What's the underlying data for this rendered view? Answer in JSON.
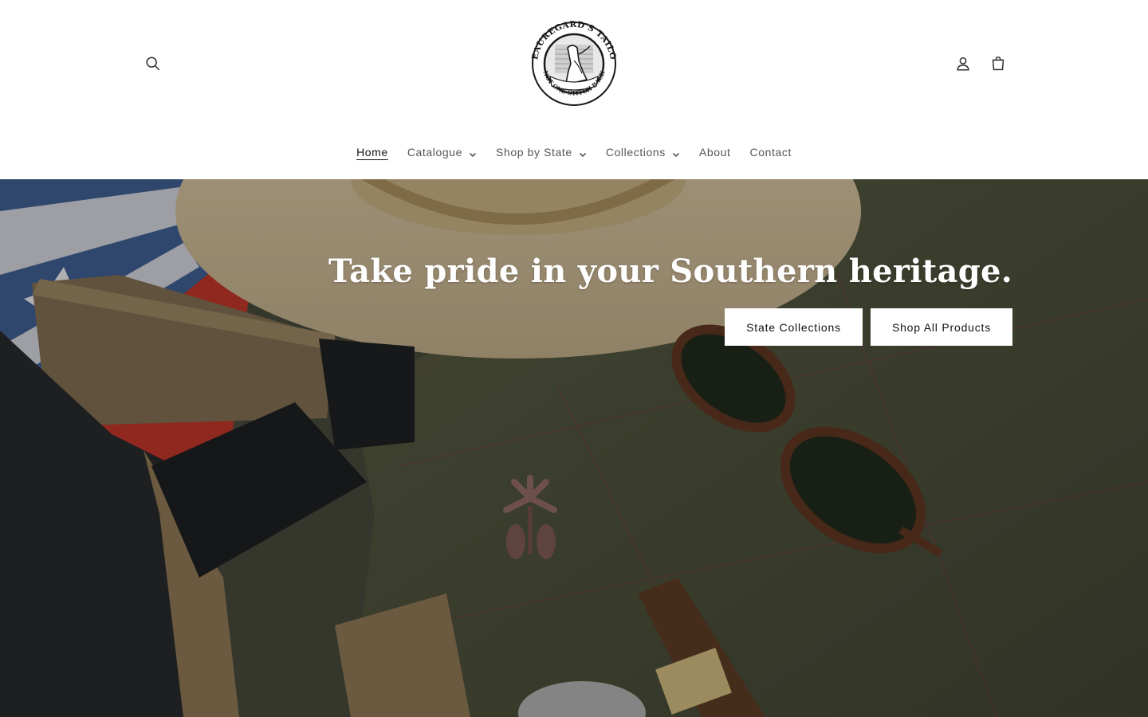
{
  "brand": {
    "logo_top_text": "BEAUREGARD'S TAILOR",
    "logo_bottom_text": "NOT ONE STITCH BACK"
  },
  "header": {
    "icons": [
      "search-icon",
      "account-icon",
      "cart-icon"
    ]
  },
  "nav": {
    "items": [
      {
        "label": "Home",
        "active": true,
        "dropdown": false
      },
      {
        "label": "Catalogue",
        "active": false,
        "dropdown": true
      },
      {
        "label": "Shop by State",
        "active": false,
        "dropdown": true
      },
      {
        "label": "Collections",
        "active": false,
        "dropdown": true
      },
      {
        "label": "About",
        "active": false,
        "dropdown": false
      },
      {
        "label": "Contact",
        "active": false,
        "dropdown": false
      }
    ]
  },
  "hero": {
    "title": "Take pride in your Southern heritage.",
    "buttons": [
      {
        "label": "State Collections"
      },
      {
        "label": "Shop All Products"
      }
    ]
  },
  "colors": {
    "background": "#ffffff",
    "text": "#121212",
    "nav_text": "#555555",
    "button_bg": "#ffffff"
  }
}
